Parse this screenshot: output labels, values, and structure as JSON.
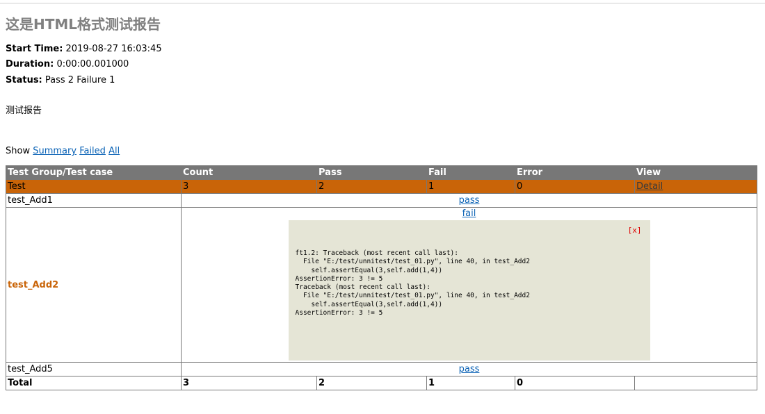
{
  "heading": "这是HTML格式测试报告",
  "attributes": {
    "start_label": "Start Time:",
    "start_value": "2019-08-27 16:03:45",
    "duration_label": "Duration:",
    "duration_value": "0:00:00.001000",
    "status_label": "Status:",
    "status_value": "Pass 2 Failure 1"
  },
  "description": "测试报告",
  "show": {
    "label": "Show",
    "summary": "Summary",
    "failed": "Failed",
    "all": "All"
  },
  "table": {
    "headers": [
      "Test Group/Test case",
      "Count",
      "Pass",
      "Fail",
      "Error",
      "View"
    ],
    "group": {
      "name": "Test",
      "count": "3",
      "pass": "2",
      "fail": "1",
      "error": "0",
      "view": "Detail"
    },
    "cases": [
      {
        "name": "test_Add1",
        "status": "pass"
      },
      {
        "name": "test_Add2",
        "status": "fail"
      },
      {
        "name": "test_Add5",
        "status": "pass"
      }
    ],
    "fail_detail": {
      "close": "[x]",
      "traceback": "ft1.2: Traceback (most recent call last):\n  File \"E:/test/unnitest/test_01.py\", line 40, in test_Add2\n    self.assertEqual(3,self.add(1,4))\nAssertionError: 3 != 5\nTraceback (most recent call last):\n  File \"E:/test/unnitest/test_01.py\", line 40, in test_Add2\n    self.assertEqual(3,self.add(1,4))\nAssertionError: 3 != 5"
    },
    "total": {
      "label": "Total",
      "count": "3",
      "pass": "2",
      "fail": "1",
      "error": "0"
    }
  },
  "colors": {
    "header_bg": "#777777",
    "group_bg": "#c96408",
    "fail_text": "#c96408",
    "detail_bg": "#e5e5d6",
    "link": "#0b63b6"
  }
}
